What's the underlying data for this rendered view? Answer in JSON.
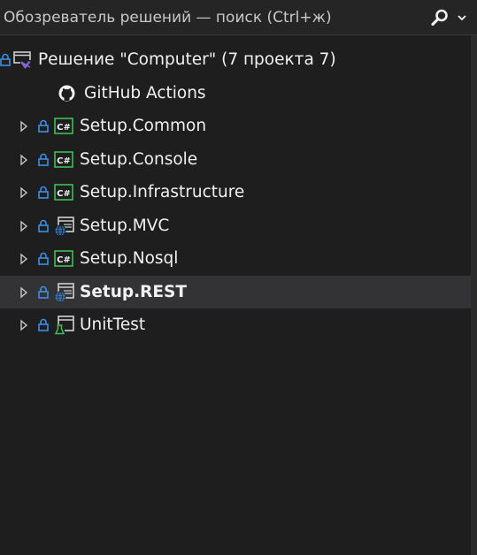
{
  "search": {
    "placeholder": "Обозреватель решений — поиск (Ctrl+ж)"
  },
  "solution": {
    "label": "Решение \"Computer\"  (7 проекта 7)"
  },
  "items": [
    {
      "label": "GitHub Actions",
      "icon": "github-icon",
      "expandable": false
    },
    {
      "label": "Setup.Common",
      "icon": "csharp-project-icon",
      "expandable": true
    },
    {
      "label": "Setup.Console",
      "icon": "csharp-project-icon",
      "expandable": true
    },
    {
      "label": "Setup.Infrastructure",
      "icon": "csharp-project-icon",
      "expandable": true
    },
    {
      "label": "Setup.MVC",
      "icon": "web-project-icon",
      "expandable": true
    },
    {
      "label": "Setup.Nosql",
      "icon": "csharp-project-icon",
      "expandable": true
    },
    {
      "label": "Setup.REST",
      "icon": "web-project-icon",
      "expandable": true,
      "selected": true
    },
    {
      "label": "UnitTest",
      "icon": "test-project-icon",
      "expandable": true
    }
  ],
  "colors": {
    "background": "#1e1e1e",
    "selection": "#333335",
    "lock": "#3c8fe6",
    "csharp": "#3fbf5a",
    "web": "#2e83d8",
    "vs": "#8a63d2"
  }
}
